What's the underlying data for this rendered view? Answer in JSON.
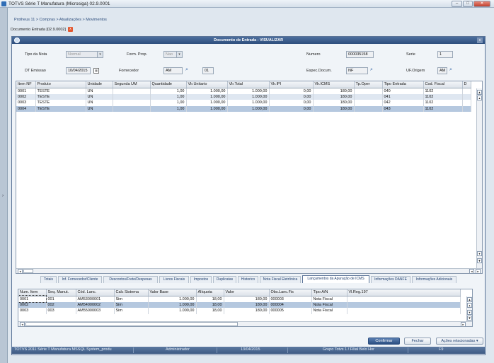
{
  "window": {
    "title": "TOTVS Série T Manufatura (Microsiga) 02.9.0001",
    "buttons": [
      "–",
      "□",
      "✕"
    ]
  },
  "breadcrumb": "Protheus 11 > Compras > Atualizações > Movimentos",
  "doc_tab": {
    "label": "Documento Entrada [02.9.0002]",
    "close": "x"
  },
  "dialog": {
    "title": "Documento de Entrada - VISUALIZAR",
    "close": "x",
    "fields": {
      "tipo_nota": {
        "label": "Tipo da Nota",
        "value": "Normal"
      },
      "form_prop": {
        "label": "Form. Prop.",
        "value": "Nao"
      },
      "numero": {
        "label": "Numero",
        "value": "000035158"
      },
      "serie": {
        "label": "Serie",
        "value": "1"
      },
      "dt_emissao": {
        "label": "DT Emissao",
        "value": "10/04/2015"
      },
      "fornecedor": {
        "label": "Fornecedor",
        "value": "AM",
        "loja": "01"
      },
      "espec_docum": {
        "label": "Espec.Docum.",
        "value": "NF"
      },
      "uf_origem": {
        "label": "UF.Origem",
        "value": "AM"
      }
    },
    "items_grid": {
      "columns": [
        "Item NF",
        "Produto",
        "Unidade",
        "Segunda UM",
        "Quantidade",
        "Vlr.Unitario",
        "Vlr.Total",
        "Vlr.IPI",
        "Vlr.ICMS",
        "Tp.Oper",
        "Tipo Entrada",
        "Cod. Fiscal",
        "D"
      ],
      "rows": [
        [
          "0001",
          "TESTE",
          "UN",
          "",
          "1,00",
          "1.000,00",
          "1.000,00",
          "0,00",
          "180,00",
          "",
          "040",
          "1102"
        ],
        [
          "0002",
          "TESTE",
          "UN",
          "",
          "1,00",
          "1.000,00",
          "1.000,00",
          "0,00",
          "180,00",
          "",
          "041",
          "1102"
        ],
        [
          "0003",
          "TESTE",
          "UN",
          "",
          "1,00",
          "1.000,00",
          "1.000,00",
          "0,00",
          "180,00",
          "",
          "042",
          "1102"
        ],
        [
          "0004",
          "TESTE",
          "UN",
          "",
          "1,00",
          "1.000,00",
          "1.000,00",
          "0,00",
          "180,00",
          "",
          "043",
          "1102"
        ]
      ]
    },
    "tabs": [
      "Totais",
      "Inf. Fornecedor/Cliente",
      "Descontos/Frete/Despesas",
      "Livros Fiscais",
      "Impostos",
      "Duplicatas",
      "Historico",
      "Nota Fiscal Eletrônica",
      "Lançamentos da Apuração de ICMS",
      "Informações DANFE",
      "Informações Adicionais"
    ],
    "active_tab_index": 8,
    "icms_grid": {
      "columns": [
        "Num. Item",
        "Seq. Manut.",
        "Cód. Lanc.",
        "Calc Sistema",
        "Valor Base",
        "Alíquota",
        "Valor",
        "Obs.Lanc.Fis",
        "Tipo A/N",
        "Vl.Reg.197"
      ],
      "rows": [
        [
          "0001",
          "001",
          "AM53000001",
          "Sim",
          "1.000,00",
          "18,00",
          "180,00",
          "000003",
          "Nota Fiscal",
          ""
        ],
        [
          "0002",
          "002",
          "AM54000002",
          "Sim",
          "1.000,00",
          "18,00",
          "180,00",
          "000004",
          "Nota Fiscal",
          ""
        ],
        [
          "0003",
          "003",
          "AM55000003",
          "Sim",
          "1.000,00",
          "18,00",
          "180,00",
          "000005",
          "Nota Fiscal",
          ""
        ]
      ]
    },
    "buttons": {
      "confirm": "Confirmar",
      "close": "Fechar",
      "actions": "Ações relacionadas"
    }
  },
  "statusbar": {
    "app": "TOTVS 2011 Série T Manufatura MSSQL System_produ",
    "user": "Administrador",
    "date": "13/04/2015",
    "branch": "Grupo Totvs 1 / Filial Belo Hor",
    "key": "F9"
  }
}
